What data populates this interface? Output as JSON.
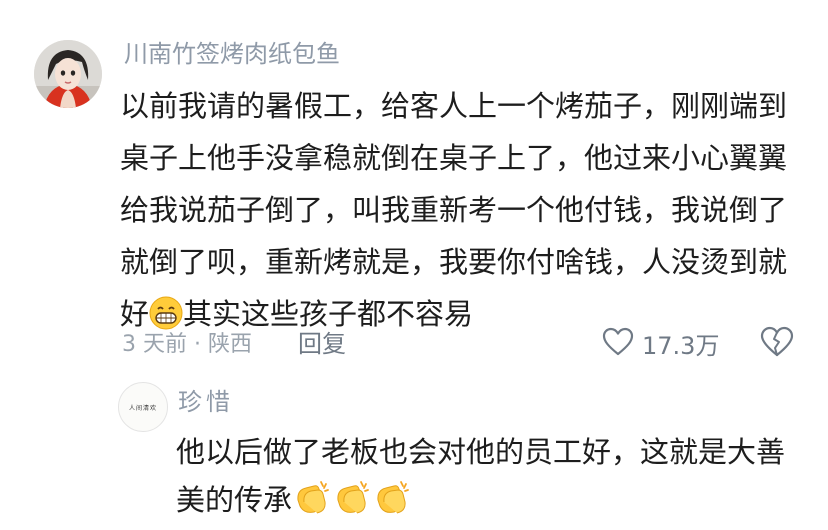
{
  "comment": {
    "username": "川南竹签烤肉纸包鱼",
    "avatar": "avatar-woman",
    "lines": [
      "以前我请的暑假工，给客人上一个烤茄子，刚刚端到",
      "桌子上他手没拿稳就倒在桌子上了，他过来小心翼翼",
      "给我说茄子倒了，叫我重新考一个他付钱，我说倒了",
      "就倒了呗，重新烤就是，我要你付啥钱，人没烫到就"
    ],
    "last_line_start": "好",
    "last_line_emoji": "grinning-face-emoji",
    "last_line_end": "其实这些孩子都不容易",
    "time_location": "3 天前 · 陕西",
    "reply_label": "回复",
    "like_icon": "heart-icon",
    "like_count": "17.3万",
    "dislike_icon": "broken-heart-icon"
  },
  "reply": {
    "username": "珍惜",
    "avatar_text": "人间清欢",
    "lines": [
      "他以后做了老板也会对他的员工好，这就是大善"
    ],
    "last_line_text": "美的传承",
    "emojis": [
      "clapping-hands-emoji",
      "clapping-hands-emoji",
      "clapping-hands-emoji"
    ]
  }
}
